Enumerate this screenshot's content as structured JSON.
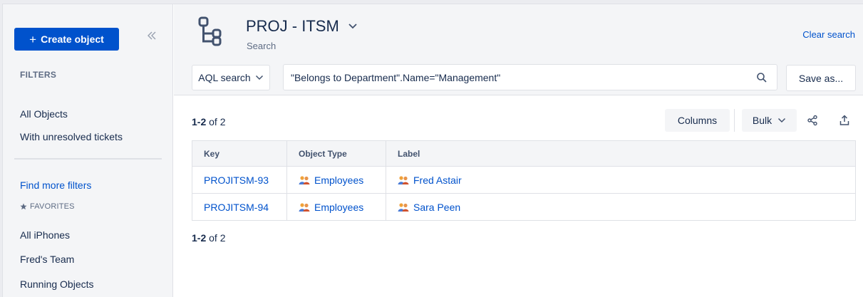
{
  "sidebar": {
    "create_button": "Create object",
    "filters_heading": "FILTERS",
    "filter_items": [
      "All Objects",
      "With unresolved tickets"
    ],
    "find_more": "Find more filters",
    "favorites_heading": "FAVORITES",
    "favorite_items": [
      "All iPhones",
      "Fred's Team",
      "Running Objects"
    ]
  },
  "header": {
    "project_title": "PROJ - ITSM",
    "subtitle": "Search",
    "clear_search": "Clear search",
    "aql_mode": "AQL search",
    "query_value": "\"Belongs to Department\".Name=\"Management\"",
    "save_as": "Save as..."
  },
  "results": {
    "count_range": "1-2",
    "count_of": "of 2",
    "columns_button": "Columns",
    "bulk_button": "Bulk",
    "table": {
      "headers": [
        "Key",
        "Object Type",
        "Label"
      ],
      "rows": [
        {
          "key": "PROJITSM-93",
          "type": "Employees",
          "label": "Fred Astair"
        },
        {
          "key": "PROJITSM-94",
          "type": "Employees",
          "label": "Sara Peen"
        }
      ]
    }
  },
  "colors": {
    "primary": "#0052cc",
    "text": "#172b4d",
    "subtle_bg": "#f4f5f7",
    "border": "#dfe1e6"
  },
  "icons": [
    "plus-icon",
    "collapse-left-icon",
    "star-icon",
    "project-tree-icon",
    "chevron-down-icon",
    "search-icon",
    "share-icon",
    "export-icon",
    "employees-icon"
  ]
}
